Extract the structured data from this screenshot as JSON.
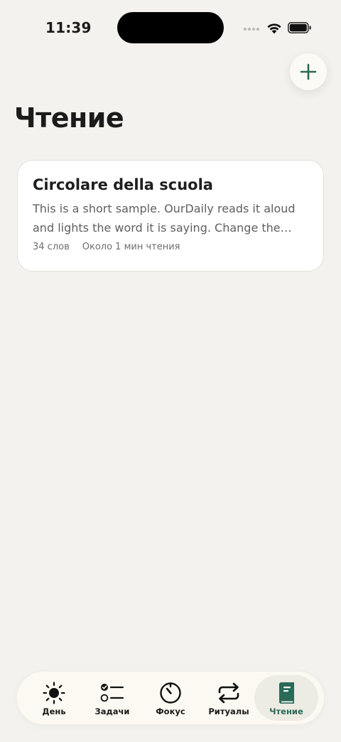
{
  "status_bar": {
    "time": "11:39"
  },
  "header": {
    "title": "Чтение",
    "add_icon": "plus-icon"
  },
  "reading_list": [
    {
      "title": "Circolare della scuola",
      "excerpt": "This is a short sample. OurDaily reads it aloud and lights the word it is saying. Change the font, size and spacing as you like.",
      "word_count": "34 слов",
      "read_time": "Около 1 мин чтения"
    }
  ],
  "tab_bar": {
    "active": "Чтение",
    "items": [
      {
        "label": "День",
        "icon": "sun-icon"
      },
      {
        "label": "Задачи",
        "icon": "task-list-icon"
      },
      {
        "label": "Фокус",
        "icon": "timer-icon"
      },
      {
        "label": "Ритуалы",
        "icon": "repeat-icon"
      },
      {
        "label": "Чтение",
        "icon": "book-icon"
      }
    ]
  },
  "colors": {
    "background": "#f4f2ee",
    "accent": "#2b6a58",
    "card": "#ffffff",
    "tab_bar": "#fbf9f1"
  }
}
